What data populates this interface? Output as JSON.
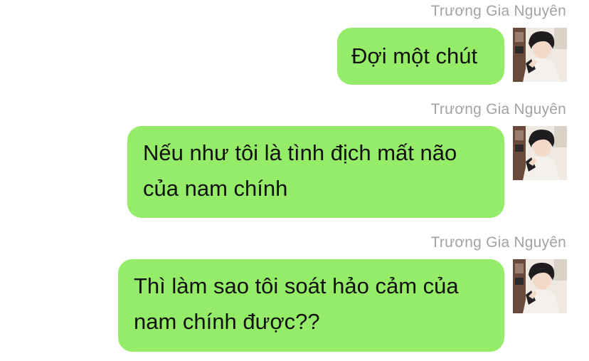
{
  "messages": [
    {
      "sender": "Trương Gia Nguyên",
      "text": "Đợi một chút",
      "avatar_icon": "user-avatar-photo"
    },
    {
      "sender": "Trương Gia Nguyên",
      "text": "Nếu như tôi là tình địch mất não của nam chính",
      "avatar_icon": "user-avatar-photo"
    },
    {
      "sender": "Trương Gia Nguyên",
      "text": "Thì làm sao tôi soát hảo cảm của nam chính được??",
      "avatar_icon": "user-avatar-photo"
    }
  ],
  "colors": {
    "bubble": "#95ec69",
    "sender_name": "#a3a3a3",
    "background": "#ffffff"
  }
}
